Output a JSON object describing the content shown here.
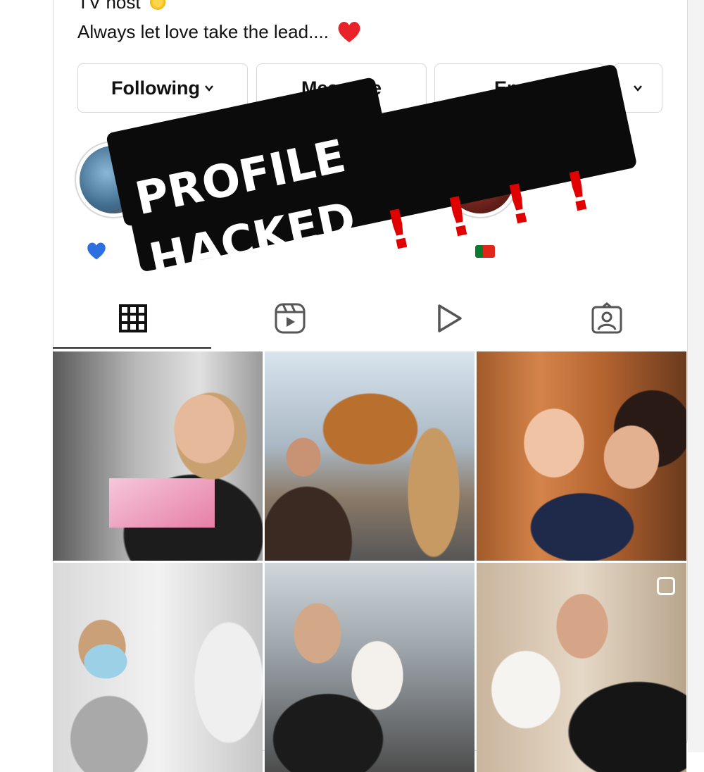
{
  "profile": {
    "bio_line_1": "TV host",
    "bio_line_2": "Always let love take the lead...."
  },
  "actions": {
    "following_label": "Following",
    "message_label": "Message",
    "email_label": "Email"
  },
  "overlay": {
    "line_1": "PROFILE",
    "line_2": "HACKED",
    "exclamations": [
      "!",
      "!",
      "!",
      "!"
    ],
    "text_color": "#ffffff",
    "bang_color": "#e10000",
    "background": "#0b0b0b"
  },
  "highlights": [
    {
      "icon": "blue-heart-emoji"
    },
    {
      "icon": "portugal-flag-emoji"
    }
  ],
  "tabs": [
    {
      "icon": "grid-icon",
      "selected": true
    },
    {
      "icon": "reels-icon",
      "selected": false
    },
    {
      "icon": "video-play-icon",
      "selected": false
    },
    {
      "icon": "tagged-person-icon",
      "selected": false
    }
  ],
  "posts": [
    {
      "icon": "photo"
    },
    {
      "icon": "photo"
    },
    {
      "icon": "photo"
    },
    {
      "icon": "photo"
    },
    {
      "icon": "photo"
    },
    {
      "icon": "multi-photo-icon"
    }
  ]
}
